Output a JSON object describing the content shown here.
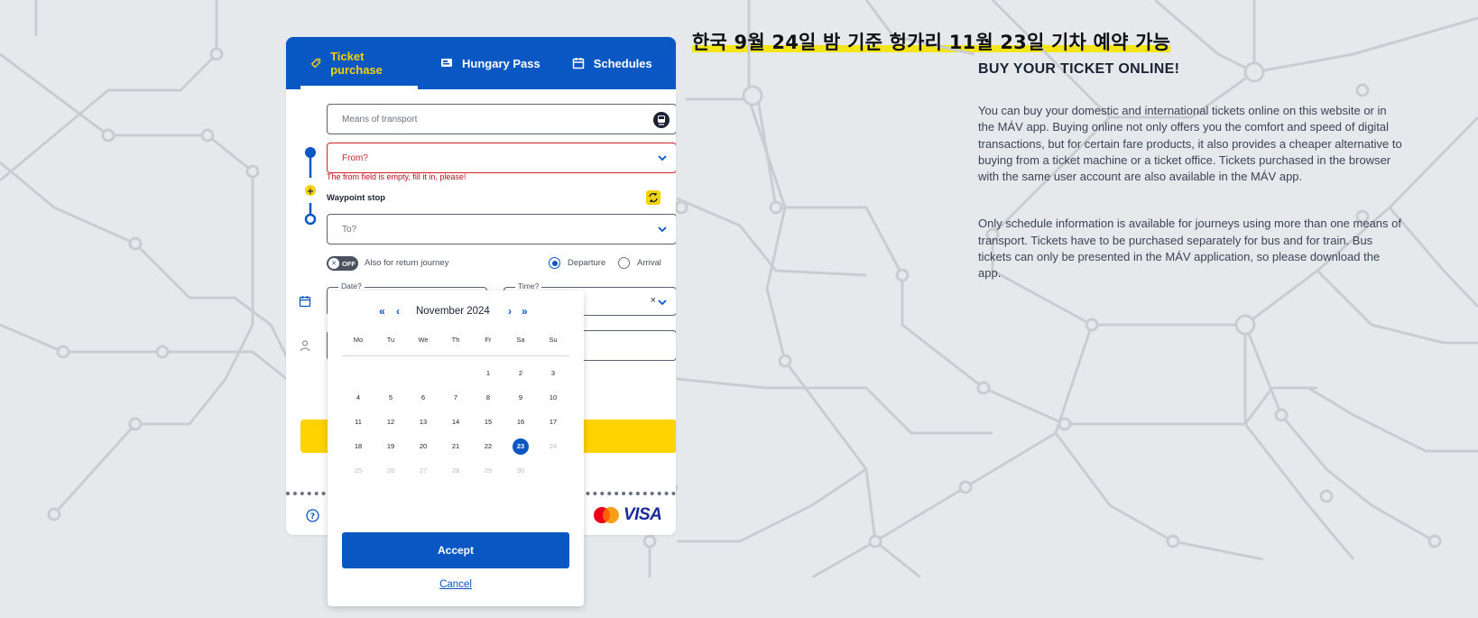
{
  "headline": "한국 9월 24일 밤 기준 헝가리 11월 23일 기차 예약 가능",
  "tabs": [
    {
      "label": "Ticket purchase",
      "icon": "ticket-icon"
    },
    {
      "label": "Hungary Pass",
      "icon": "pass-icon"
    },
    {
      "label": "Schedules",
      "icon": "calendar-icon"
    }
  ],
  "form": {
    "transport_placeholder": "Means of transport",
    "from_placeholder": "From?",
    "from_error": "The from field is empty, fill it in, please!",
    "waypoint_label": "Waypoint stop",
    "to_placeholder": "To?",
    "toggle_state": "OFF",
    "return_label": "Also for return journey",
    "departure_label": "Departure",
    "arrival_label": "Arrival",
    "date_label": "Date?",
    "time_label": "Time?",
    "clear_symbol": "×"
  },
  "payment": {
    "visa": "VISA"
  },
  "calendar": {
    "month_title": "November 2024",
    "prev_year": "«",
    "prev_month": "‹",
    "next_month": "›",
    "next_year": "»",
    "weekdays": [
      "Mo",
      "Tu",
      "We",
      "Th",
      "Fr",
      "Sa",
      "Su"
    ],
    "selected_day": "23",
    "accept_label": "Accept",
    "cancel_label": "Cancel"
  },
  "info": {
    "title": "BUY YOUR TICKET ONLINE!",
    "paragraph1": "You can buy your domestic and international tickets online on this website or in the MÁV app. Buying online not only offers you the comfort and speed of digital transactions, but for certain fare products, it also provides a cheaper alternative to buying from a ticket machine or a ticket office. Tickets purchased in the browser with the same user account are also available in the MÁV app.",
    "paragraph2": "Only schedule information is available for journeys using more than one means of transport. Tickets have to be purchased separately for bus and for train. Bus tickets can only be presented in the MÁV application, so please download the app."
  },
  "colors": {
    "brand_blue": "#0857c3",
    "accent_yellow": "#ffd200",
    "error_red": "#d2232a"
  }
}
